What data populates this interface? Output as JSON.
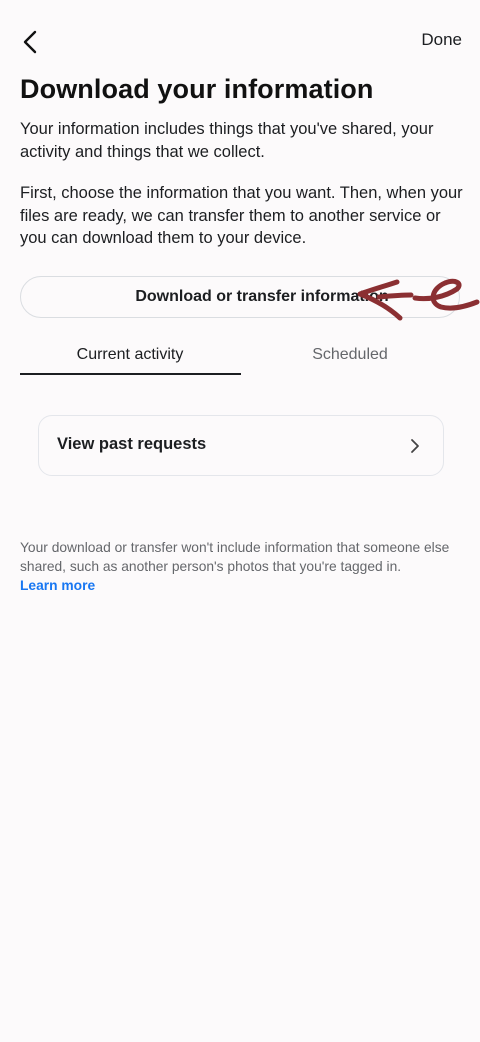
{
  "header": {
    "back_icon": "chevron-left-icon",
    "done_label": "Done"
  },
  "title": "Download your information",
  "intro": {
    "paragraph1": "Your information includes things that you've shared, your activity and things that we collect.",
    "paragraph2": "First, choose the information that you want. Then, when your files are ready, we can transfer them to another service or you can download them to your device."
  },
  "primary_button": {
    "label": "Download or transfer information"
  },
  "annotation": {
    "description": "hand-drawn arrow",
    "color": "#8b2f32"
  },
  "tabs": [
    {
      "label": "Current activity",
      "active": true
    },
    {
      "label": "Scheduled",
      "active": false
    }
  ],
  "past_requests": {
    "label": "View past requests",
    "icon": "chevron-right-icon"
  },
  "footnote": {
    "text": "Your download or transfer won't include information that someone else shared, such as another person's photos that you're tagged in.",
    "link": "Learn more",
    "link_color": "#1877f2"
  }
}
